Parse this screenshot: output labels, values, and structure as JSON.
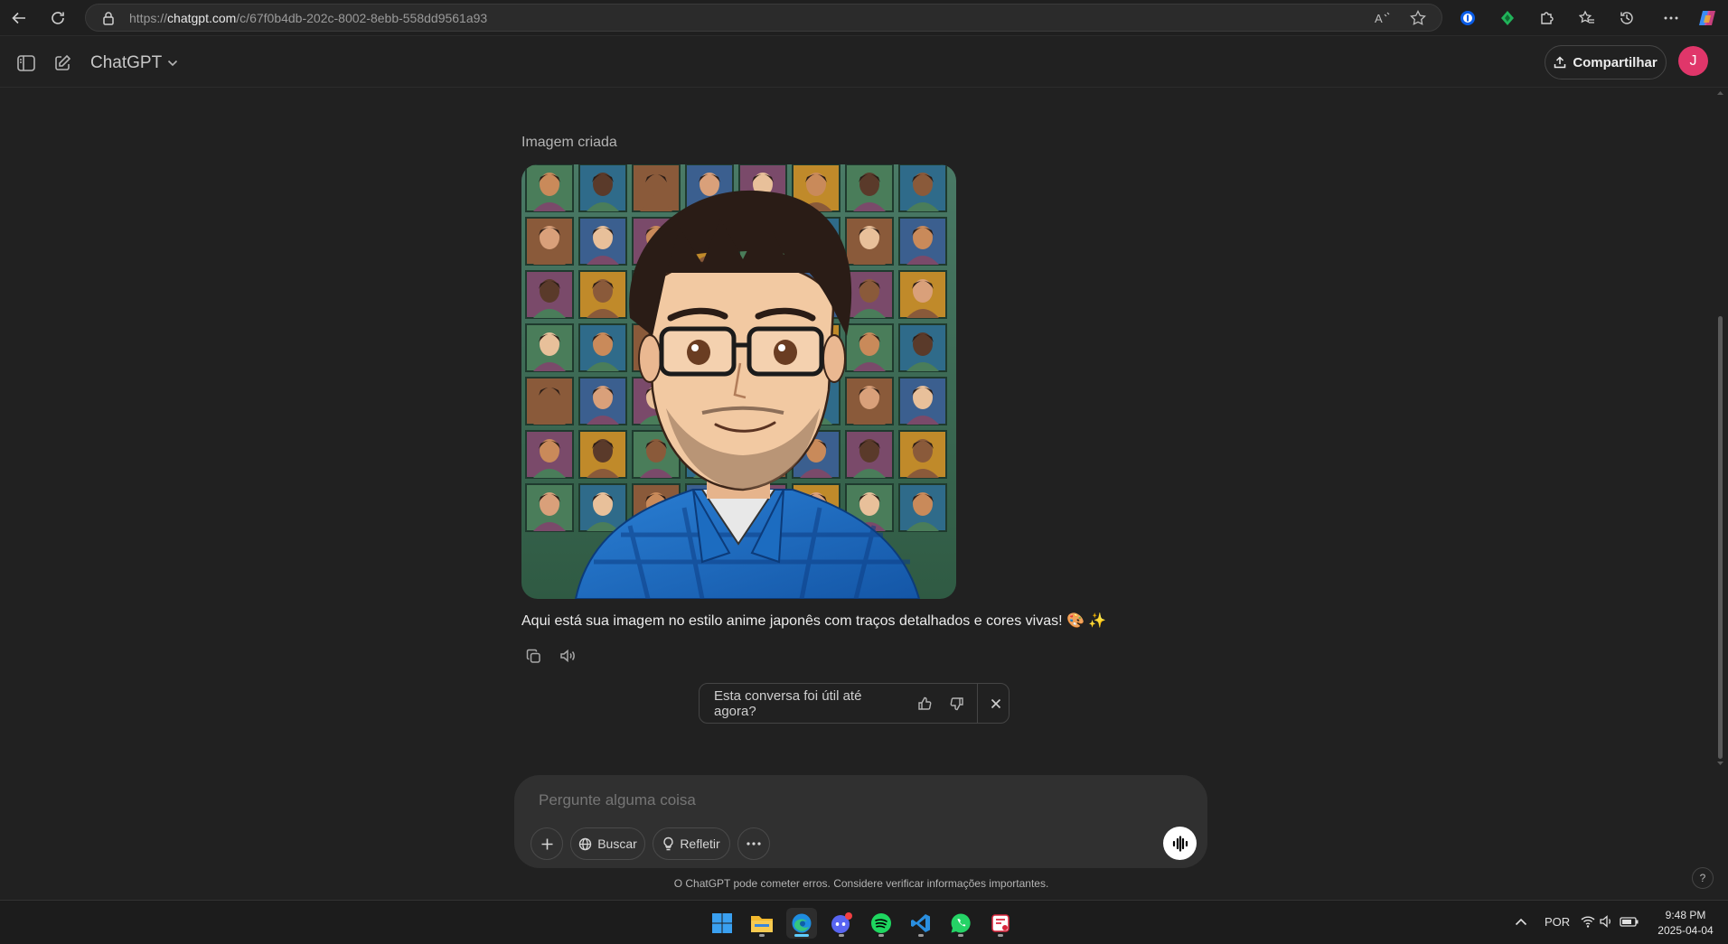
{
  "browser": {
    "url_prefix": "https://",
    "url_domain": "chatgpt.com",
    "url_path": "/c/67f0b4db-202c-8002-8ebb-558dd9561a93"
  },
  "header": {
    "model_name": "ChatGPT",
    "share_label": "Compartilhar",
    "avatar_initial": "J"
  },
  "conversation": {
    "image_caption": "Imagem criada",
    "message_text": "Aqui está sua imagem no estilo anime japonês com traços detalhados e cores vivas! 🎨 ✨"
  },
  "feedback": {
    "question": "Esta conversa foi útil até agora?"
  },
  "composer": {
    "placeholder": "Pergunte alguma coisa",
    "search_label": "Buscar",
    "reason_label": "Refletir"
  },
  "footer": {
    "disclaimer": "O ChatGPT pode cometer erros. Considere verificar informações importantes.",
    "help": "?"
  },
  "taskbar": {
    "language": "POR",
    "time": "9:48 PM",
    "date": "2025-04-04",
    "apps": [
      "start-icon",
      "file-explorer-icon",
      "edge-icon",
      "discord-icon",
      "spotify-icon",
      "vscode-icon",
      "whatsapp-icon",
      "snipping-tool-icon"
    ]
  },
  "colors": {
    "background": "#212121",
    "composer": "#303030",
    "avatar": "#e0366a",
    "accent": "#60cdff"
  }
}
